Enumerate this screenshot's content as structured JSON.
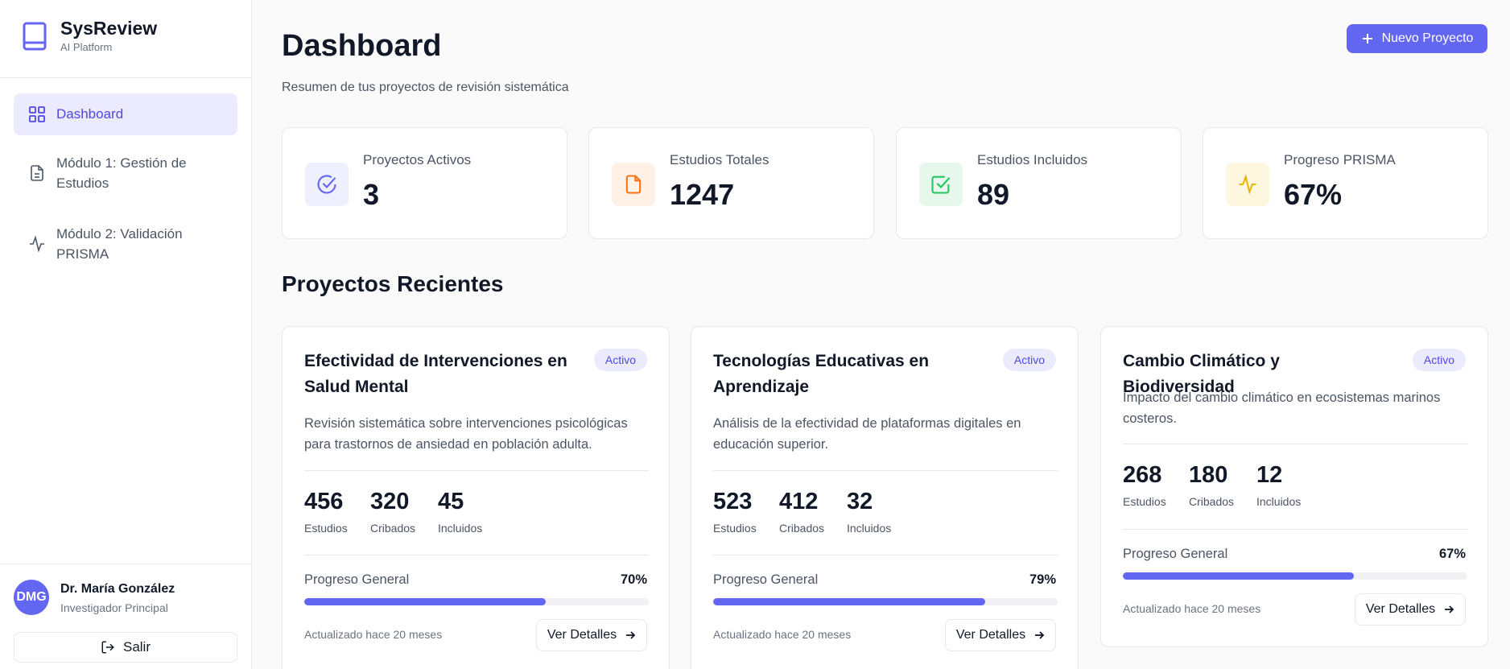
{
  "brand": {
    "title": "SysReview",
    "subtitle": "AI Platform",
    "icon": "book-icon"
  },
  "sidebar": {
    "items": [
      {
        "label": "Dashboard",
        "icon": "grid-icon",
        "active": true
      },
      {
        "label": "Módulo 1: Gestión de Estudios",
        "icon": "document-icon",
        "active": false
      },
      {
        "label": "Módulo 2: Validación PRISMA",
        "icon": "activity-icon",
        "active": false
      }
    ]
  },
  "user": {
    "initials": "DMG",
    "name": "Dr. María González",
    "role": "Investigador Principal",
    "logout_label": "Salir"
  },
  "header": {
    "title": "Dashboard",
    "subtitle": "Resumen de tus proyectos de revisión sistemática",
    "new_project_label": "Nuevo Proyecto"
  },
  "stats": [
    {
      "label": "Proyectos Activos",
      "value": "3",
      "icon": "check-circle-icon",
      "color": "#6366f1",
      "bg": "#eef0fe"
    },
    {
      "label": "Estudios Totales",
      "value": "1247",
      "icon": "file-icon",
      "color": "#f97316",
      "bg": "#fff1e6"
    },
    {
      "label": "Estudios Incluidos",
      "value": "89",
      "icon": "check-square-icon",
      "color": "#22c55e",
      "bg": "#e6f8ec"
    },
    {
      "label": "Progreso PRISMA",
      "value": "67%",
      "icon": "activity-icon",
      "color": "#eab308",
      "bg": "#fef7e0"
    }
  ],
  "section_title": "Proyectos Recientes",
  "projects": [
    {
      "title": "Efectividad de Intervenciones en Salud Mental",
      "status": "Activo",
      "description": "Revisión sistemática sobre intervenciones psicológicas para trastornos de ansiedad en población adulta.",
      "metrics": [
        {
          "value": "456",
          "label": "Estudios"
        },
        {
          "value": "320",
          "label": "Cribados"
        },
        {
          "value": "45",
          "label": "Incluidos"
        }
      ],
      "progress_label": "Progreso General",
      "progress_text": "70%",
      "progress": 0.7,
      "updated": "Actualizado hace 20 meses",
      "details_label": "Ver Detalles"
    },
    {
      "title": "Tecnologías Educativas en Aprendizaje",
      "status": "Activo",
      "description": "Análisis de la efectividad de plataformas digitales en educación superior.",
      "metrics": [
        {
          "value": "523",
          "label": "Estudios"
        },
        {
          "value": "412",
          "label": "Cribados"
        },
        {
          "value": "32",
          "label": "Incluidos"
        }
      ],
      "progress_label": "Progreso General",
      "progress_text": "79%",
      "progress": 0.79,
      "updated": "Actualizado hace 20 meses",
      "details_label": "Ver Detalles"
    },
    {
      "title": "Cambio Climático y Biodiversidad",
      "status": "Activo",
      "description": "Impacto del cambio climático en ecosistemas marinos costeros.",
      "metrics": [
        {
          "value": "268",
          "label": "Estudios"
        },
        {
          "value": "180",
          "label": "Cribados"
        },
        {
          "value": "12",
          "label": "Incluidos"
        }
      ],
      "progress_label": "Progreso General",
      "progress_text": "67%",
      "progress": 0.67,
      "updated": "Actualizado hace 20 meses",
      "details_label": "Ver Detalles"
    }
  ],
  "colors": {
    "accent": "#6366f1",
    "accent_soft": "#ecebfd"
  }
}
